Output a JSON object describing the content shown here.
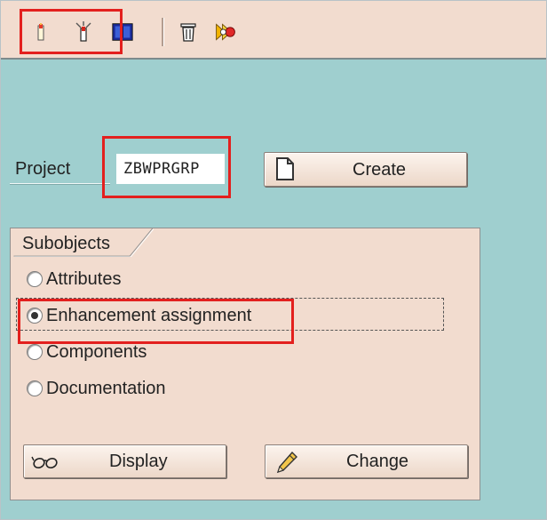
{
  "toolbar": {
    "buttons": [
      {
        "icon": "create-object-icon"
      },
      {
        "icon": "delete-object-icon"
      },
      {
        "icon": "overview-icon"
      },
      {
        "icon": "trash-icon"
      },
      {
        "icon": "activate-icon"
      }
    ]
  },
  "project": {
    "label": "Project",
    "value": "ZBWPRGRP",
    "create_label": "Create"
  },
  "subobjects": {
    "title": "Subobjects",
    "options": [
      {
        "label": "Attributes",
        "checked": false
      },
      {
        "label": "Enhancement assignment",
        "checked": true
      },
      {
        "label": "Components",
        "checked": false
      },
      {
        "label": "Documentation",
        "checked": false
      }
    ],
    "display_label": "Display",
    "change_label": "Change"
  },
  "colors": {
    "background": "#9fcfcf",
    "panel": "#f2dccf",
    "highlight": "#e3201e"
  }
}
